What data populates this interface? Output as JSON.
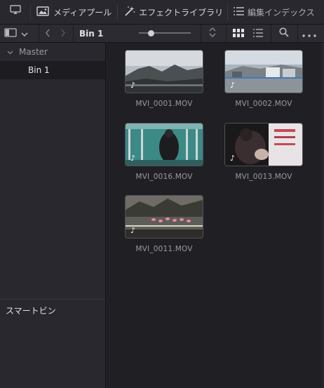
{
  "toolbar": {
    "media_pool_label": "メディアプール",
    "effects_label": "エフェクトライブラリ",
    "edit_index_label": "編集インデックス"
  },
  "bin_bar": {
    "bin_title": "Bin 1"
  },
  "sidebar": {
    "master_label": "Master",
    "bin_label": "Bin 1",
    "smart_bins_label": "スマートビン"
  },
  "clips": [
    {
      "name": "MVI_0001.MOV",
      "scene": "mountain"
    },
    {
      "name": "MVI_0002.MOV",
      "scene": "town"
    },
    {
      "name": "MVI_0016.MOV",
      "scene": "station"
    },
    {
      "name": "MVI_0013.MOV",
      "scene": "people"
    },
    {
      "name": "MVI_0011.MOV",
      "scene": "flamingos"
    }
  ],
  "colors": {
    "background": "#1f1f24",
    "panel": "#28282e",
    "selected_row": "#1c1c21",
    "text_dim": "#9a9aa2"
  }
}
